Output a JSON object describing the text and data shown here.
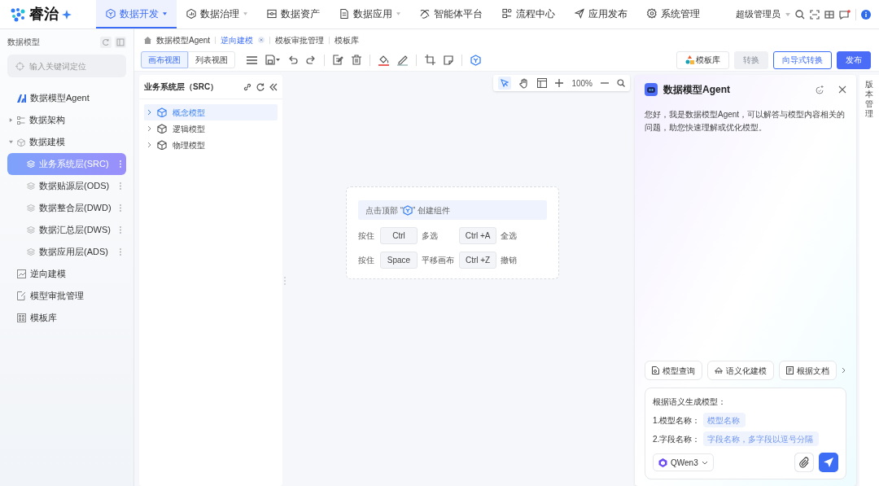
{
  "brand": {
    "name": "睿治"
  },
  "nav": [
    {
      "label": "数据开发",
      "selected": true,
      "dropdown": true
    },
    {
      "label": "数据治理",
      "selected": false,
      "dropdown": true
    },
    {
      "label": "数据资产",
      "selected": false,
      "dropdown": false
    },
    {
      "label": "数据应用",
      "selected": false,
      "dropdown": true
    },
    {
      "label": "智能体平台",
      "selected": false,
      "dropdown": false
    },
    {
      "label": "流程中心",
      "selected": false,
      "dropdown": false
    },
    {
      "label": "应用发布",
      "selected": false,
      "dropdown": false
    },
    {
      "label": "系统管理",
      "selected": false,
      "dropdown": false
    }
  ],
  "user": {
    "name": "超级管理员"
  },
  "sidebar": {
    "title": "数据模型",
    "search": {
      "placeholder": "输入关键词定位"
    },
    "items": [
      {
        "label": "数据模型Agent",
        "kind": "agent"
      },
      {
        "label": "数据架构",
        "kind": "folder",
        "expanded": false
      },
      {
        "label": "数据建模",
        "kind": "folder",
        "expanded": true,
        "children": [
          {
            "label": "业务系统层(SRC)",
            "selected": true
          },
          {
            "label": "数据贴源层(ODS)",
            "selected": false
          },
          {
            "label": "数据整合层(DWD)",
            "selected": false
          },
          {
            "label": "数据汇总层(DWS)",
            "selected": false
          },
          {
            "label": "数据应用层(ADS)",
            "selected": false
          }
        ]
      },
      {
        "label": "逆向建模",
        "kind": "chart"
      },
      {
        "label": "模型审批管理",
        "kind": "edit"
      },
      {
        "label": "模板库",
        "kind": "grid"
      }
    ]
  },
  "breadcrumbs": [
    {
      "label": "数据模型Agent",
      "active": false
    },
    {
      "label": "逆向建模",
      "active": true
    },
    {
      "label": "模板审批管理",
      "active": false
    },
    {
      "label": "模板库",
      "active": false
    }
  ],
  "view_tabs": [
    {
      "label": "画布视图",
      "selected": true
    },
    {
      "label": "列表视图",
      "selected": false
    }
  ],
  "actions": [
    {
      "label": "模板库",
      "kind": "icon"
    },
    {
      "label": "转换",
      "kind": "disabled"
    },
    {
      "label": "向导式转换",
      "kind": "outline"
    },
    {
      "label": "发布",
      "kind": "primary"
    }
  ],
  "tree": {
    "title": "业务系统层（SRC）",
    "items": [
      {
        "label": "概念模型",
        "selected": true
      },
      {
        "label": "逻辑模型",
        "selected": false
      },
      {
        "label": "物理模型",
        "selected": false
      }
    ]
  },
  "canvas": {
    "zoom": "100%",
    "hint_before": "点击顶部 “",
    "hint_after": "” 创建组件",
    "shortcuts": [
      {
        "prefix": "按住",
        "key": "Ctrl",
        "action": "多选"
      },
      {
        "key": "Ctrl +A",
        "action": "全选"
      },
      {
        "prefix": "按住",
        "key": "Space",
        "action": "平移画布"
      },
      {
        "key": "Ctrl +Z",
        "action": "撤销"
      }
    ]
  },
  "agent": {
    "title": "数据模型Agent",
    "greeting": "您好，我是数据模型Agent，可以解答与模型内容相关的问题，助您快速理解或优化模型。",
    "quick_actions": [
      "模型查询",
      "语义化建模",
      "根据文档"
    ],
    "prompt": {
      "heading": "根据语义生成模型：",
      "fields": [
        {
          "label": "1.模型名称：",
          "placeholder": "模型名称"
        },
        {
          "label": "2.字段名称：",
          "placeholder": "字段名称，多字段以逗号分隔"
        }
      ]
    },
    "model": "QWen3"
  },
  "version_panel": {
    "label": "版本管理"
  }
}
